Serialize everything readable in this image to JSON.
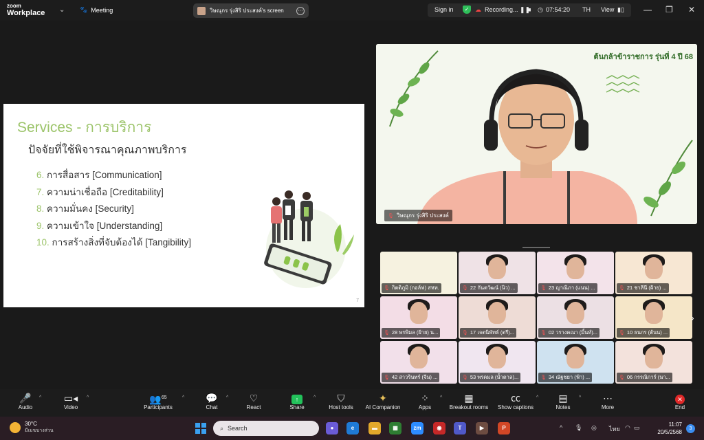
{
  "topbar": {
    "logo_line1": "zoom",
    "logo_line2": "Workplace",
    "meeting_label": "Meeting",
    "share_owner": "วิษณุกร รุ่งสิริ ประสงค์'s screen",
    "sign_in": "Sign in",
    "recording_label": "Recording...",
    "timer": "07:54:20",
    "lang": "TH",
    "view_label": "View"
  },
  "slide": {
    "title": "Services - การบริการ",
    "subtitle": "ปัจจัยที่ใช้พิจารณาคุณภาพบริการ",
    "items": [
      {
        "num": "6.",
        "text": "การสื่อสาร [Communication]"
      },
      {
        "num": "7.",
        "text": "ความน่าเชื่อถือ [Creditability]"
      },
      {
        "num": "8.",
        "text": "ความมั่นคง [Security]"
      },
      {
        "num": "9.",
        "text": "ความเข้าใจ [Understanding]"
      },
      {
        "num": "10.",
        "text": "การสร้างสิ่งที่จับต้องได้ [Tangibility]"
      }
    ],
    "page": "7"
  },
  "speaker": {
    "banner": "ต้นกล้าข้าราชการ รุ่นที่ 4 ปี 68",
    "name": "วิษณุกร รุ่งสิริ ประสงค์"
  },
  "participants": [
    {
      "label": "กิตติภูมิ (กอล์ฟ) สหท.",
      "bg": "#f6f2e0"
    },
    {
      "label": "22 กันตวัฒน์ (นิว) ...",
      "bg": "#efe2e6"
    },
    {
      "label": "23 ญาณิภา (แนน) ...",
      "bg": "#f3e3ea"
    },
    {
      "label": "21 ชาลีนี (ฝ้าย) ...",
      "bg": "#f7e7d3"
    },
    {
      "label": "28 พรพิมล (ฝ้าย) น...",
      "bg": "#f3dde6"
    },
    {
      "label": "17 เจตนิพัทธ์ (ตรี)...",
      "bg": "#eedcd6"
    },
    {
      "label": "02 วรางคณา (มิ้นท์)...",
      "bg": "#ece0e4"
    },
    {
      "label": "10 ธนกร (ต้นน) ...",
      "bg": "#f5e6c8"
    },
    {
      "label": "42 สาวรินทร์ (จีน) ...",
      "bg": "#f2e0ea"
    },
    {
      "label": "53 พรคมล (น้ำตาล)...",
      "bg": "#f0e6f0"
    },
    {
      "label": "34 ณัฐชยา (ฟ้า) ...",
      "bg": "#cfe2f0"
    },
    {
      "label": "06 กรรณิการ์ (นา...",
      "bg": "#f3e2dc"
    }
  ],
  "toolbar": {
    "audio": "Audio",
    "video": "Video",
    "participants": "Participants",
    "participants_count": "65",
    "chat": "Chat",
    "react": "React",
    "share": "Share",
    "host_tools": "Host tools",
    "ai_companion": "AI Companion",
    "apps": "Apps",
    "breakout": "Breakout rooms",
    "captions": "Show captions",
    "notes": "Notes",
    "more": "More",
    "end": "End"
  },
  "taskbar": {
    "temp": "30°C",
    "weather": "มีเมฆบางส่วน",
    "search": "Search",
    "tray_lang": "ไทย",
    "time": "11:07",
    "date": "20/5/2568",
    "notif_count": "3"
  },
  "colors": {
    "slide_accent": "#9cc46a",
    "share_green": "#23c25b",
    "end_red": "#e02828"
  }
}
